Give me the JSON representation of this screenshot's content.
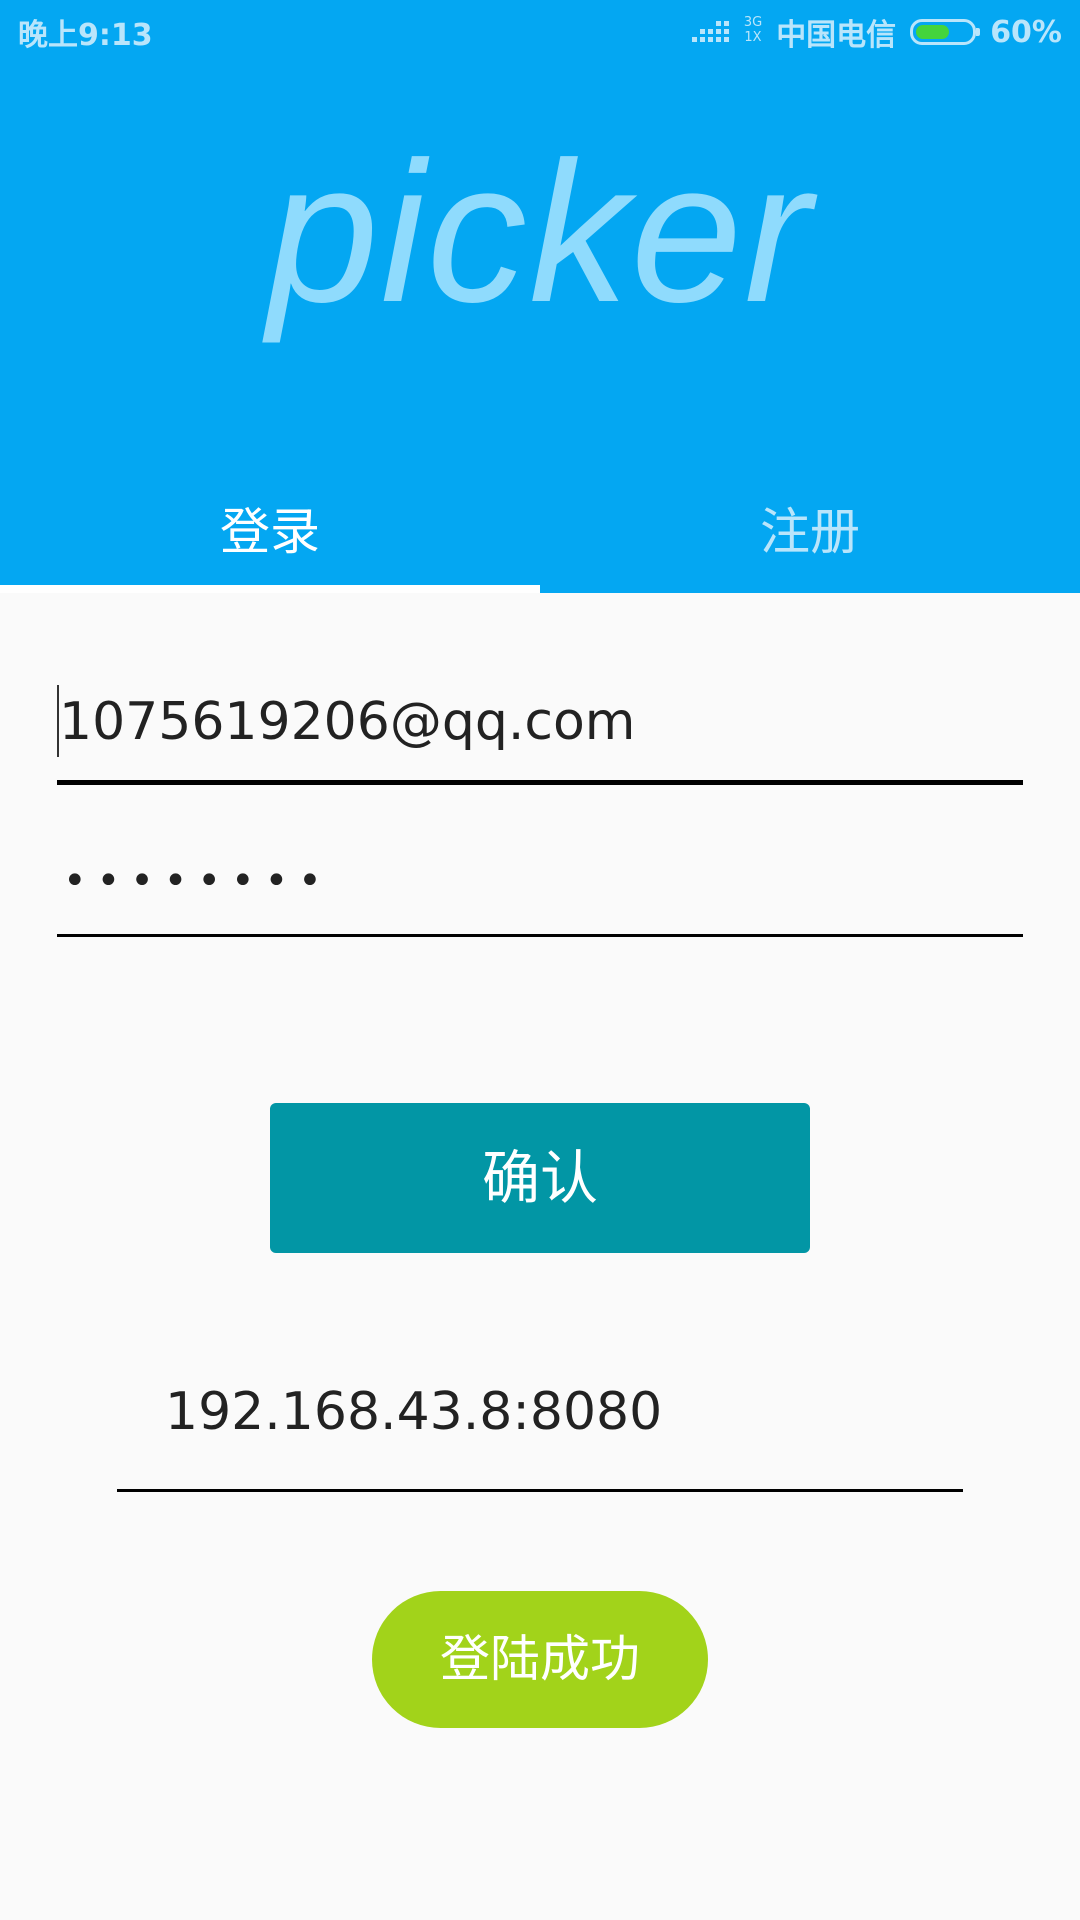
{
  "status_bar": {
    "time": "晚上9:13",
    "network": "3G\n1X",
    "carrier": "中国电信",
    "battery_percent": "60%",
    "battery_level": 0.6,
    "battery_color": "#44d43c"
  },
  "header": {
    "logo": "picker",
    "background_color": "#04a7f2"
  },
  "tabs": [
    {
      "label": "登录",
      "active": true
    },
    {
      "label": "注册",
      "active": false
    }
  ],
  "form": {
    "email_value": "1075619206@qq.com",
    "password_value": "••••••••",
    "confirm_label": "确认",
    "confirm_color": "#0296a5",
    "server_value": "192.168.43.8:8080",
    "success_label": "登陆成功",
    "success_color": "#a2d31a"
  }
}
